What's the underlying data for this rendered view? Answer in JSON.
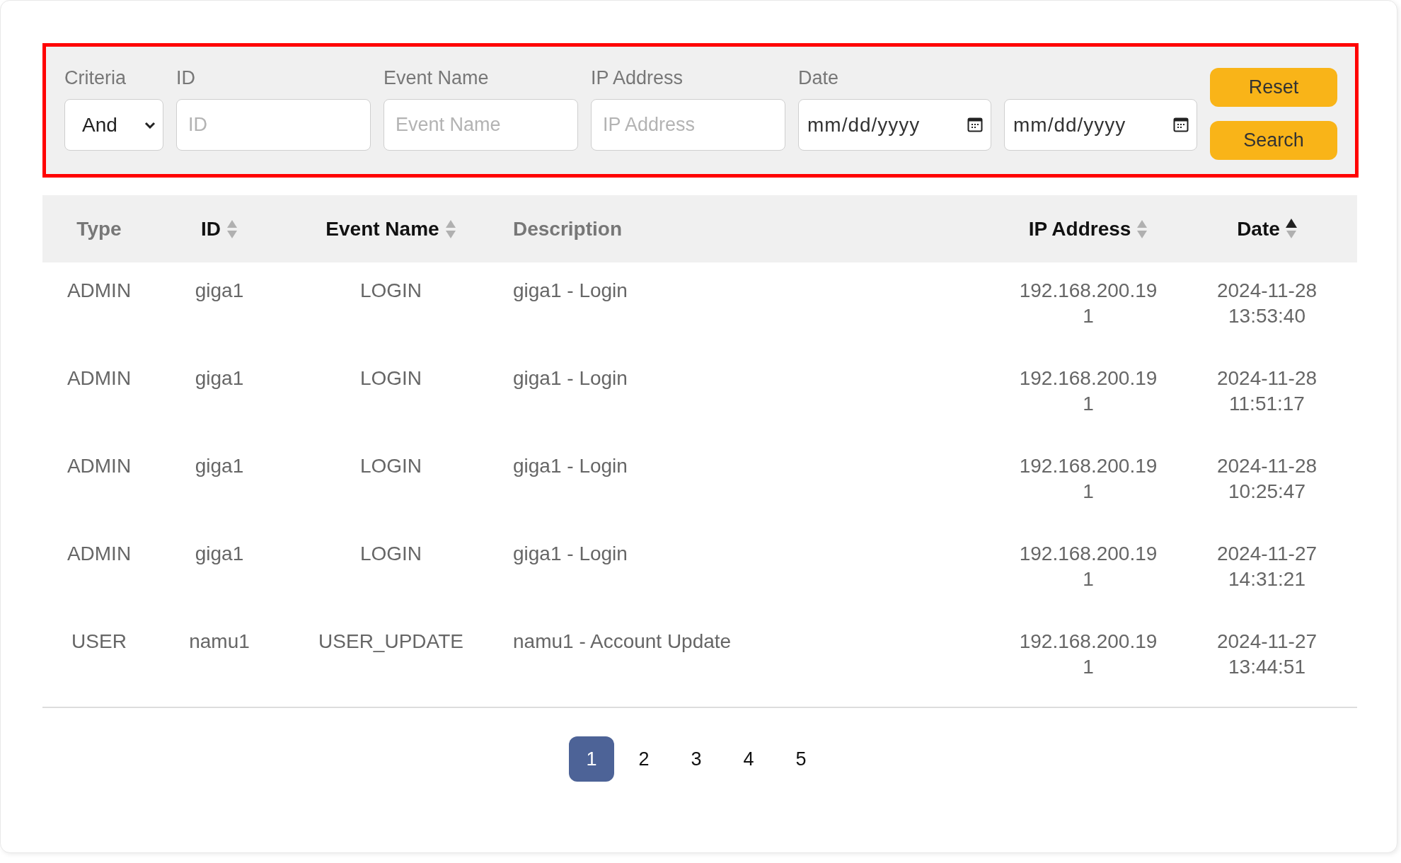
{
  "filters": {
    "criteria": {
      "label": "Criteria",
      "value": "And"
    },
    "id": {
      "label": "ID",
      "placeholder": "ID"
    },
    "event_name": {
      "label": "Event Name",
      "placeholder": "Event Name"
    },
    "ip_address": {
      "label": "IP Address",
      "placeholder": "IP Address"
    },
    "date": {
      "label": "Date",
      "from_placeholder": "mm/dd/yyyy",
      "to_placeholder": "mm/dd/yyyy"
    },
    "buttons": [
      "Reset",
      "Search"
    ]
  },
  "table": {
    "columns": [
      {
        "label": "Type",
        "sortable": false
      },
      {
        "label": "ID",
        "sortable": true,
        "sorted_ascending": false
      },
      {
        "label": "Event Name",
        "sortable": true,
        "sorted_ascending": false
      },
      {
        "label": "Description",
        "sortable": false
      },
      {
        "label": "IP Address",
        "sortable": true,
        "sorted_ascending": false
      },
      {
        "label": "Date",
        "sortable": true,
        "sorted_ascending": true
      }
    ],
    "rows": [
      [
        "ADMIN",
        "giga1",
        "LOGIN",
        "giga1 - Login",
        "192.168.200.191",
        "2024-11-28 13:53:40"
      ],
      [
        "ADMIN",
        "giga1",
        "LOGIN",
        "giga1 - Login",
        "192.168.200.191",
        "2024-11-28 11:51:17"
      ],
      [
        "ADMIN",
        "giga1",
        "LOGIN",
        "giga1 - Login",
        "192.168.200.191",
        "2024-11-28 10:25:47"
      ],
      [
        "ADMIN",
        "giga1",
        "LOGIN",
        "giga1 - Login",
        "192.168.200.191",
        "2024-11-27 14:31:21"
      ],
      [
        "USER",
        "namu1",
        "USER_UPDATE",
        "namu1 - Account Update",
        "192.168.200.191",
        "2024-11-27 13:44:51"
      ]
    ]
  },
  "pagination": [
    {
      "label": "1",
      "selected": true
    },
    {
      "label": "2",
      "selected": false
    },
    {
      "label": "3",
      "selected": false
    },
    {
      "label": "4",
      "selected": false
    },
    {
      "label": "5",
      "selected": false
    }
  ]
}
